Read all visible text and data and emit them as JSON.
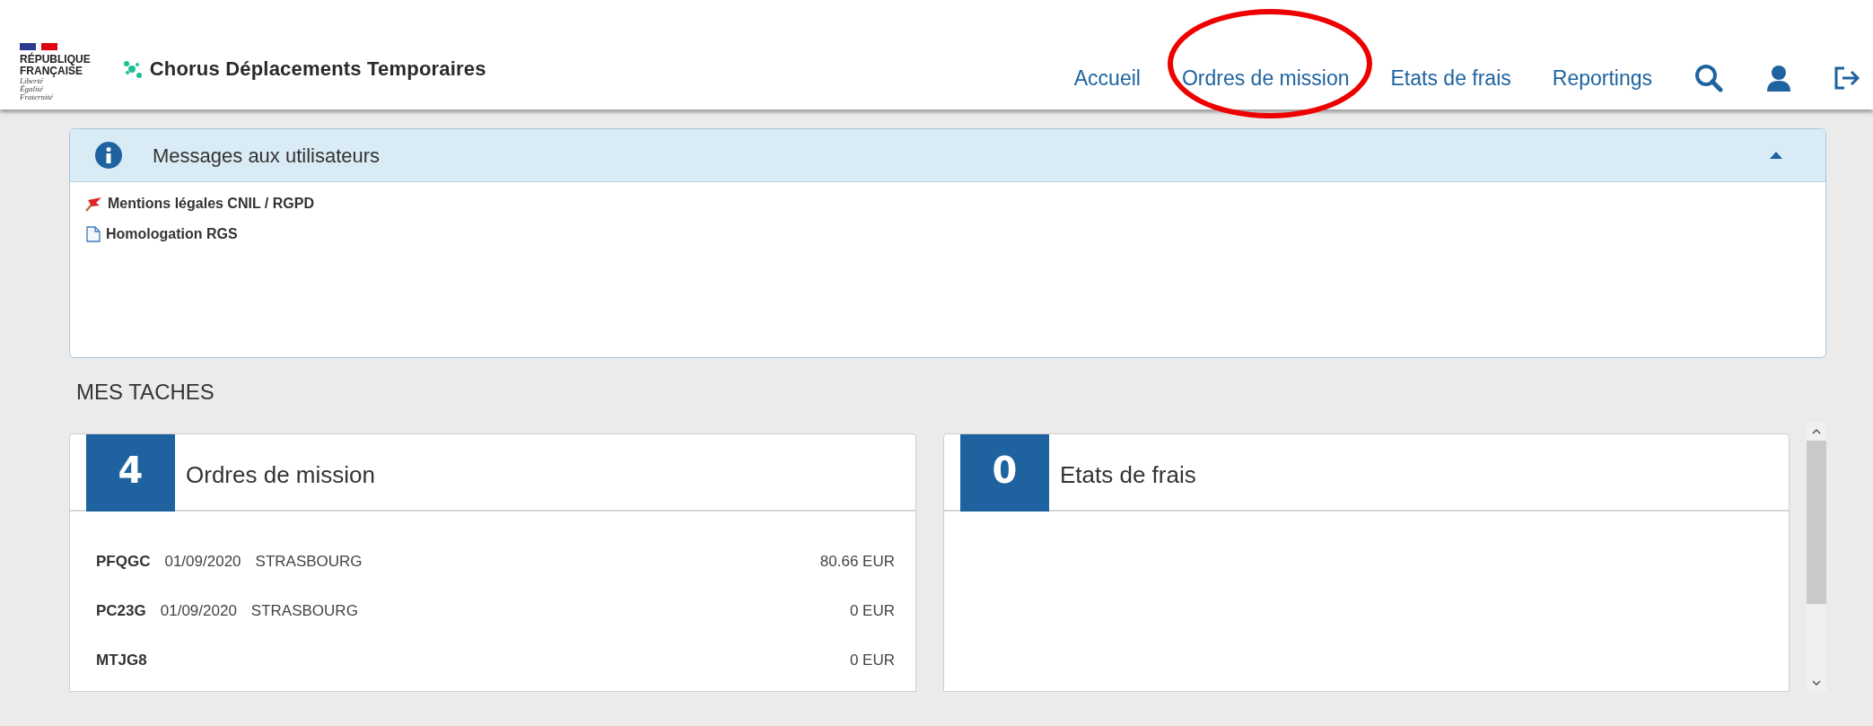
{
  "header": {
    "logo": {
      "line_1": "RÉPUBLIQUE",
      "line_2": "FRANÇAISE",
      "motto": [
        "Liberté",
        "Égalité",
        "Fraternité"
      ]
    },
    "app_title": "Chorus Déplacements Temporaires",
    "nav": [
      {
        "label": "Accueil",
        "highlighted": false
      },
      {
        "label": "Ordres de mission",
        "highlighted": true
      },
      {
        "label": "Etats de frais",
        "highlighted": false
      },
      {
        "label": "Reportings",
        "highlighted": false
      }
    ]
  },
  "messages": {
    "title": "Messages aux utilisateurs",
    "expanded": true,
    "items": [
      {
        "kind": "flag",
        "label": "Mentions légales CNIL / RGPD"
      },
      {
        "kind": "document",
        "label": "Homologation RGS"
      }
    ]
  },
  "tasks": {
    "title": "MES TACHES",
    "cards": [
      {
        "count": "4",
        "title": "Ordres de mission",
        "rows": [
          {
            "code": "PFQGC",
            "date": "01/09/2020",
            "city": "STRASBOURG",
            "amount": "80.66 EUR"
          },
          {
            "code": "PC23G",
            "date": "01/09/2020",
            "city": "STRASBOURG",
            "amount": "0 EUR"
          },
          {
            "code": "MTJG8",
            "amount": "0 EUR"
          }
        ]
      },
      {
        "count": "0",
        "title": "Etats de frais"
      }
    ]
  }
}
